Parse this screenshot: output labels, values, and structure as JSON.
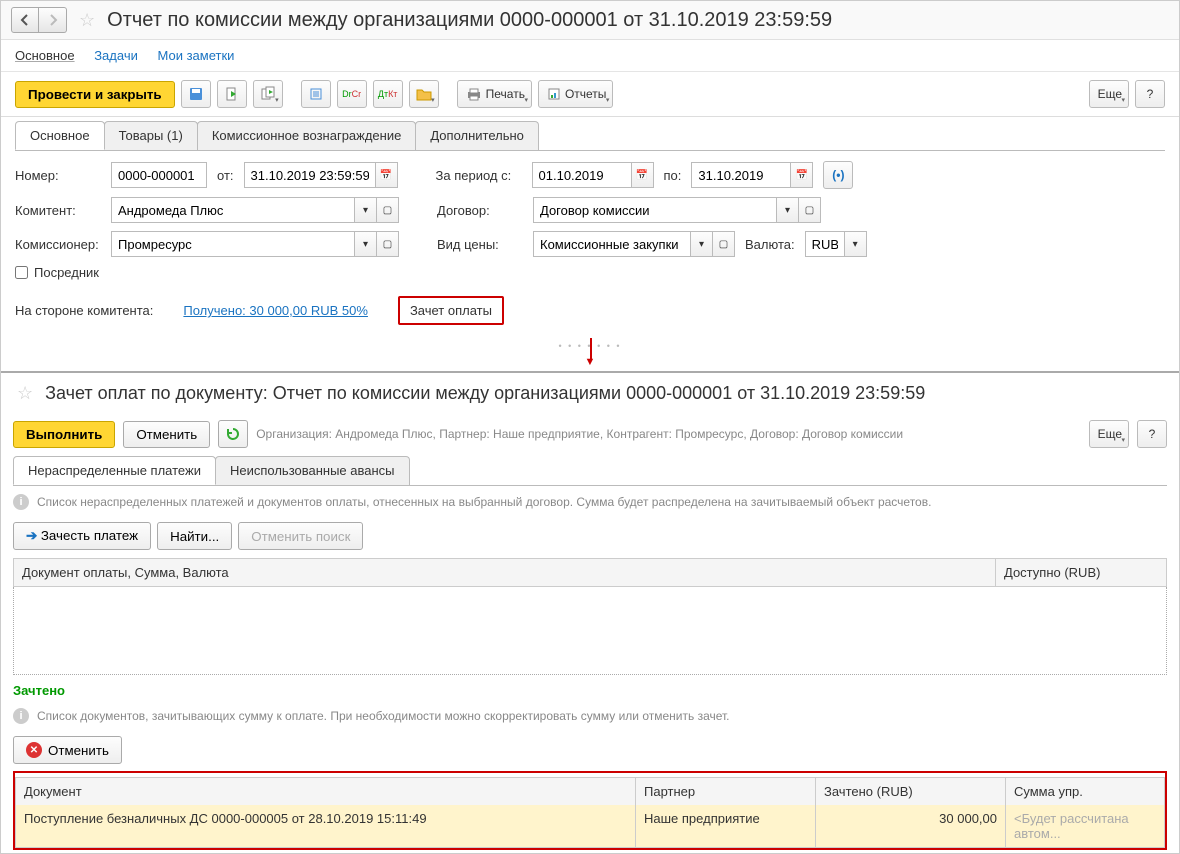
{
  "top": {
    "title": "Отчет по комиссии между организациями 0000-000001 от 31.10.2019 23:59:59",
    "nav": {
      "main": "Основное",
      "tasks": "Задачи",
      "notes": "Мои заметки"
    },
    "toolbar": {
      "post_close": "Провести и закрыть",
      "print": "Печать",
      "reports": "Отчеты",
      "more": "Еще",
      "help": "?"
    },
    "tabs": {
      "main": "Основное",
      "goods": "Товары (1)",
      "commission": "Комиссионное вознаграждение",
      "extra": "Дополнительно"
    },
    "form": {
      "number_label": "Номер:",
      "number": "0000-000001",
      "from_label": "от:",
      "date": "31.10.2019 23:59:59",
      "period_from_label": "За период с:",
      "period_from": "01.10.2019",
      "period_to_label": "по:",
      "period_to": "31.10.2019",
      "kommitent_label": "Комитент:",
      "kommitent": "Андромеда Плюс",
      "contract_label": "Договор:",
      "contract": "Договор комиссии",
      "commissioner_label": "Комиссионер:",
      "commissioner": "Промресурс",
      "price_type_label": "Вид цены:",
      "price_type": "Комиссионные закупки",
      "currency_label": "Валюта:",
      "currency": "RUB",
      "intermediary": "Посредник",
      "side_label": "На стороне комитента:",
      "received_link": "Получено: 30 000,00 RUB  50%",
      "offset_btn": "Зачет оплаты"
    }
  },
  "bottom": {
    "title": "Зачет оплат по документу: Отчет по комиссии между организациями 0000-000001 от 31.10.2019 23:59:59",
    "toolbar": {
      "execute": "Выполнить",
      "cancel": "Отменить",
      "context": "Организация: Андромеда Плюс, Партнер: Наше предприятие, Контрагент: Промресурс, Договор: Договор комиссии",
      "more": "Еще",
      "help": "?"
    },
    "tabs": {
      "unalloc": "Нераспределенные платежи",
      "unused": "Неиспользованные авансы"
    },
    "info1": "Список нераспределенных платежей и документов оплаты, отнесенных на выбранный договор. Сумма будет распределена на зачитываемый объект расчетов.",
    "local": {
      "apply": "Зачесть платеж",
      "find": "Найти...",
      "cancel_search": "Отменить поиск"
    },
    "table1": {
      "col1": "Документ оплаты, Сумма, Валюта",
      "col2": "Доступно (RUB)"
    },
    "credited_label": "Зачтено",
    "info2": "Список документов, зачитывающих сумму к оплате. При необходимости можно скорректировать сумму или отменить зачет.",
    "cancel_btn": "Отменить",
    "table2": {
      "h1": "Документ",
      "h2": "Партнер",
      "h3": "Зачтено (RUB)",
      "h4": "Сумма упр.",
      "r1c1": "Поступление безналичных ДС 0000-000005 от 28.10.2019 15:11:49",
      "r1c2": "Наше предприятие",
      "r1c3": "30 000,00",
      "r1c4": "<Будет рассчитана автом..."
    }
  }
}
